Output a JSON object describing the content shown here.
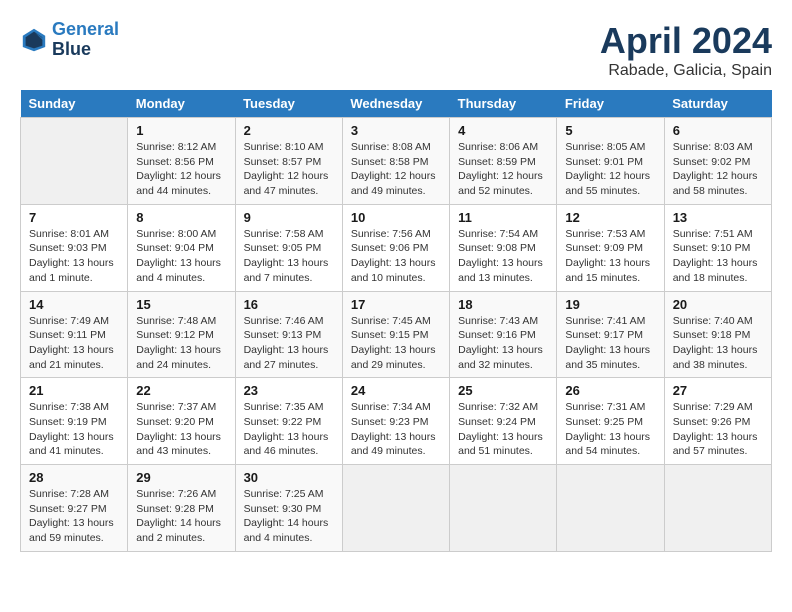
{
  "header": {
    "logo_line1": "General",
    "logo_line2": "Blue",
    "title": "April 2024",
    "subtitle": "Rabade, Galicia, Spain"
  },
  "calendar": {
    "days_of_week": [
      "Sunday",
      "Monday",
      "Tuesday",
      "Wednesday",
      "Thursday",
      "Friday",
      "Saturday"
    ],
    "weeks": [
      [
        {
          "day": "",
          "info": ""
        },
        {
          "day": "1",
          "info": "Sunrise: 8:12 AM\nSunset: 8:56 PM\nDaylight: 12 hours\nand 44 minutes."
        },
        {
          "day": "2",
          "info": "Sunrise: 8:10 AM\nSunset: 8:57 PM\nDaylight: 12 hours\nand 47 minutes."
        },
        {
          "day": "3",
          "info": "Sunrise: 8:08 AM\nSunset: 8:58 PM\nDaylight: 12 hours\nand 49 minutes."
        },
        {
          "day": "4",
          "info": "Sunrise: 8:06 AM\nSunset: 8:59 PM\nDaylight: 12 hours\nand 52 minutes."
        },
        {
          "day": "5",
          "info": "Sunrise: 8:05 AM\nSunset: 9:01 PM\nDaylight: 12 hours\nand 55 minutes."
        },
        {
          "day": "6",
          "info": "Sunrise: 8:03 AM\nSunset: 9:02 PM\nDaylight: 12 hours\nand 58 minutes."
        }
      ],
      [
        {
          "day": "7",
          "info": "Sunrise: 8:01 AM\nSunset: 9:03 PM\nDaylight: 13 hours\nand 1 minute."
        },
        {
          "day": "8",
          "info": "Sunrise: 8:00 AM\nSunset: 9:04 PM\nDaylight: 13 hours\nand 4 minutes."
        },
        {
          "day": "9",
          "info": "Sunrise: 7:58 AM\nSunset: 9:05 PM\nDaylight: 13 hours\nand 7 minutes."
        },
        {
          "day": "10",
          "info": "Sunrise: 7:56 AM\nSunset: 9:06 PM\nDaylight: 13 hours\nand 10 minutes."
        },
        {
          "day": "11",
          "info": "Sunrise: 7:54 AM\nSunset: 9:08 PM\nDaylight: 13 hours\nand 13 minutes."
        },
        {
          "day": "12",
          "info": "Sunrise: 7:53 AM\nSunset: 9:09 PM\nDaylight: 13 hours\nand 15 minutes."
        },
        {
          "day": "13",
          "info": "Sunrise: 7:51 AM\nSunset: 9:10 PM\nDaylight: 13 hours\nand 18 minutes."
        }
      ],
      [
        {
          "day": "14",
          "info": "Sunrise: 7:49 AM\nSunset: 9:11 PM\nDaylight: 13 hours\nand 21 minutes."
        },
        {
          "day": "15",
          "info": "Sunrise: 7:48 AM\nSunset: 9:12 PM\nDaylight: 13 hours\nand 24 minutes."
        },
        {
          "day": "16",
          "info": "Sunrise: 7:46 AM\nSunset: 9:13 PM\nDaylight: 13 hours\nand 27 minutes."
        },
        {
          "day": "17",
          "info": "Sunrise: 7:45 AM\nSunset: 9:15 PM\nDaylight: 13 hours\nand 29 minutes."
        },
        {
          "day": "18",
          "info": "Sunrise: 7:43 AM\nSunset: 9:16 PM\nDaylight: 13 hours\nand 32 minutes."
        },
        {
          "day": "19",
          "info": "Sunrise: 7:41 AM\nSunset: 9:17 PM\nDaylight: 13 hours\nand 35 minutes."
        },
        {
          "day": "20",
          "info": "Sunrise: 7:40 AM\nSunset: 9:18 PM\nDaylight: 13 hours\nand 38 minutes."
        }
      ],
      [
        {
          "day": "21",
          "info": "Sunrise: 7:38 AM\nSunset: 9:19 PM\nDaylight: 13 hours\nand 41 minutes."
        },
        {
          "day": "22",
          "info": "Sunrise: 7:37 AM\nSunset: 9:20 PM\nDaylight: 13 hours\nand 43 minutes."
        },
        {
          "day": "23",
          "info": "Sunrise: 7:35 AM\nSunset: 9:22 PM\nDaylight: 13 hours\nand 46 minutes."
        },
        {
          "day": "24",
          "info": "Sunrise: 7:34 AM\nSunset: 9:23 PM\nDaylight: 13 hours\nand 49 minutes."
        },
        {
          "day": "25",
          "info": "Sunrise: 7:32 AM\nSunset: 9:24 PM\nDaylight: 13 hours\nand 51 minutes."
        },
        {
          "day": "26",
          "info": "Sunrise: 7:31 AM\nSunset: 9:25 PM\nDaylight: 13 hours\nand 54 minutes."
        },
        {
          "day": "27",
          "info": "Sunrise: 7:29 AM\nSunset: 9:26 PM\nDaylight: 13 hours\nand 57 minutes."
        }
      ],
      [
        {
          "day": "28",
          "info": "Sunrise: 7:28 AM\nSunset: 9:27 PM\nDaylight: 13 hours\nand 59 minutes."
        },
        {
          "day": "29",
          "info": "Sunrise: 7:26 AM\nSunset: 9:28 PM\nDaylight: 14 hours\nand 2 minutes."
        },
        {
          "day": "30",
          "info": "Sunrise: 7:25 AM\nSunset: 9:30 PM\nDaylight: 14 hours\nand 4 minutes."
        },
        {
          "day": "",
          "info": ""
        },
        {
          "day": "",
          "info": ""
        },
        {
          "day": "",
          "info": ""
        },
        {
          "day": "",
          "info": ""
        }
      ]
    ]
  }
}
